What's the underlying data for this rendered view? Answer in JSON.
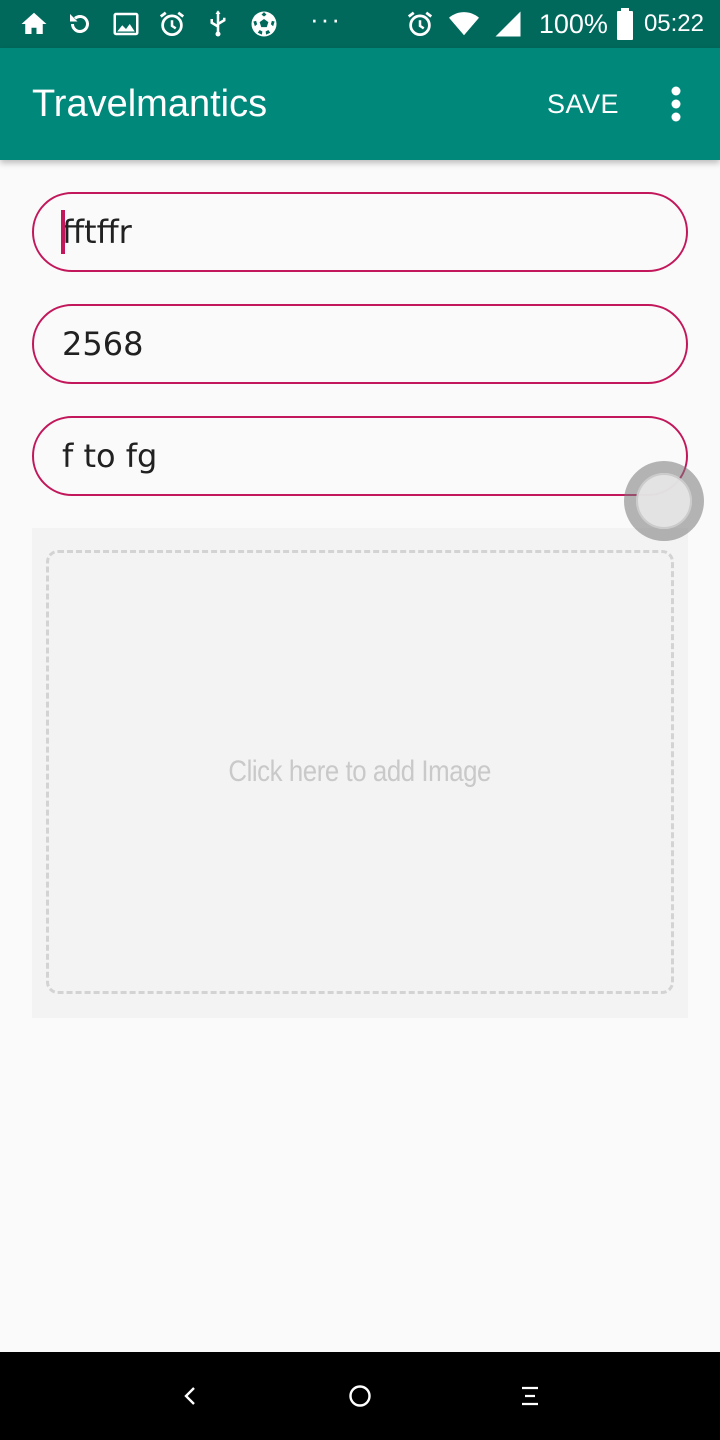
{
  "status_bar": {
    "left_icons": [
      "home-icon",
      "sync-icon",
      "image-icon",
      "alarm-icon",
      "usb-icon",
      "soccer-ball-icon"
    ],
    "overflow_dots": "···",
    "right_icons": [
      "alarm-icon",
      "wifi-icon",
      "cell-signal-icon",
      "battery-icon"
    ],
    "battery_percent": "100%",
    "time": "05:22"
  },
  "app_bar": {
    "title": "Travelmantics",
    "save_label": "SAVE",
    "overflow_icon": "more-vert-icon"
  },
  "form": {
    "title_value": "fftffr",
    "price_value": "2568",
    "description_value": "f to fg"
  },
  "image_picker": {
    "hint": "Click here to add Image"
  },
  "nav_bar": {
    "icons": [
      "back-icon",
      "home-circle-icon",
      "recents-icon"
    ]
  },
  "colors": {
    "status_bar": "#00695c",
    "app_bar": "#00897b",
    "accent": "#c2185b",
    "background": "#fafafa"
  }
}
